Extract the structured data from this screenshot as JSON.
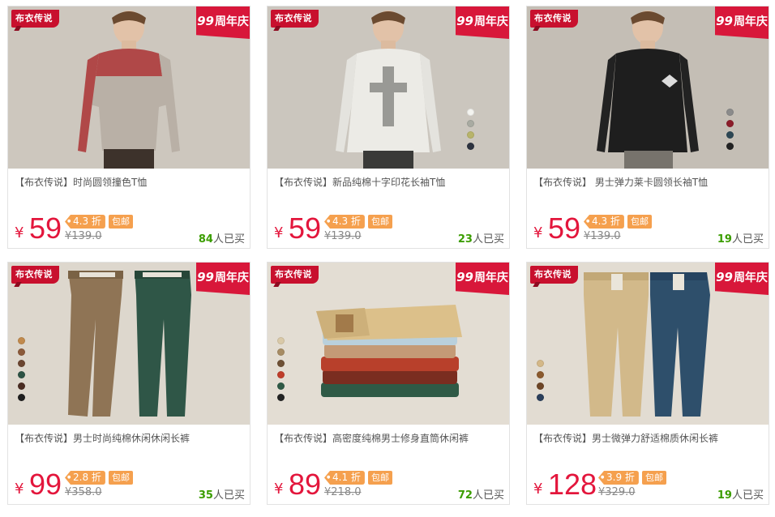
{
  "anniversary_label": "周年庆",
  "anniversary_num": "99",
  "products": [
    {
      "brand_tag": "布衣传说",
      "title": "【布衣传说】时尚圆领撞色T恤",
      "currency": "¥",
      "price": "59",
      "discount": "4.3 折",
      "free_shipping": "包邮",
      "original_price": "¥139.0",
      "sold_count": "84",
      "sold_suffix": "人已买",
      "swatches": []
    },
    {
      "brand_tag": "布衣传说",
      "title": "【布衣传说】新品纯棉十字印花长袖T恤",
      "currency": "¥",
      "price": "59",
      "discount": "4.3 折",
      "free_shipping": "包邮",
      "original_price": "¥139.0",
      "sold_count": "23",
      "sold_suffix": "人已买",
      "swatches": [
        "#f4f4f0",
        "#a9aba2",
        "#b8b46a",
        "#2d3340"
      ]
    },
    {
      "brand_tag": "布衣传说",
      "title": "【布衣传说】 男士弹力莱卡圆领长袖T恤",
      "currency": "¥",
      "price": "59",
      "discount": "4.3 折",
      "free_shipping": "包邮",
      "original_price": "¥139.0",
      "sold_count": "19",
      "sold_suffix": "人已买",
      "swatches": [
        "#8b8b8b",
        "#8c1d2a",
        "#2d4754",
        "#222222"
      ]
    },
    {
      "brand_tag": "布衣传说",
      "title": "【布衣传说】男士时尚纯棉休闲休闲长裤",
      "currency": "¥",
      "price": "99",
      "discount": "2.8 折",
      "free_shipping": "包邮",
      "original_price": "¥358.0",
      "sold_count": "35",
      "sold_suffix": "人已买",
      "swatches": [
        "#c18a4d",
        "#8b5a3a",
        "#6b4530",
        "#2c5244",
        "#4a2c22",
        "#1f1f1f"
      ]
    },
    {
      "brand_tag": "布衣传说",
      "title": "【布衣传说】高密度纯棉男士修身直筒休闲裤",
      "currency": "¥",
      "price": "89",
      "discount": "4.1 折",
      "free_shipping": "包邮",
      "original_price": "¥218.0",
      "sold_count": "72",
      "sold_suffix": "人已买",
      "swatches": [
        "#d9c9a8",
        "#a78c64",
        "#6e5035",
        "#bf3d2a",
        "#2f5a46",
        "#232323"
      ]
    },
    {
      "brand_tag": "布衣传说",
      "title": "【布衣传说】男士微弹力舒适棉质休闲长裤",
      "currency": "¥",
      "price": "128",
      "discount": "3.9 折",
      "free_shipping": "包邮",
      "original_price": "¥329.0",
      "sold_count": "19",
      "sold_suffix": "人已买",
      "swatches": [
        "#d4b888",
        "#8b5a2e",
        "#6d4526",
        "#2b3f5c"
      ]
    }
  ]
}
